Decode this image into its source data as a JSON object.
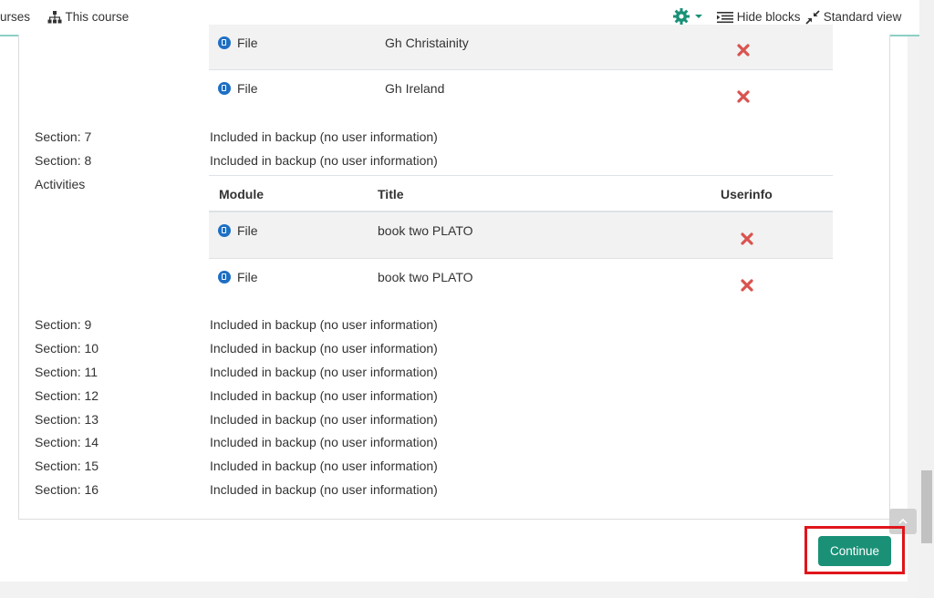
{
  "nav": {
    "courses_partial": "urses",
    "this_course": "This course",
    "hide_blocks": "Hide blocks",
    "standard_view": "Standard view"
  },
  "top_table": {
    "rows": [
      {
        "module": "File",
        "title": "Gh Christainity"
      },
      {
        "module": "File",
        "title": "Gh Ireland"
      }
    ]
  },
  "sections_a": [
    {
      "label": "Section: 7",
      "value": "Included in backup (no user information)"
    },
    {
      "label": "Section: 8",
      "value": "Included in backup (no user information)"
    }
  ],
  "activities_label": "Activities",
  "activities_table": {
    "headers": {
      "module": "Module",
      "title": "Title",
      "userinfo": "Userinfo"
    },
    "rows": [
      {
        "module": "File",
        "title": "book two PLATO"
      },
      {
        "module": "File",
        "title": "book two PLATO"
      }
    ]
  },
  "sections_b": [
    {
      "label": "Section: 9",
      "value": "Included in backup (no user information)"
    },
    {
      "label": "Section: 10",
      "value": "Included in backup (no user information)"
    },
    {
      "label": "Section: 11",
      "value": "Included in backup (no user information)"
    },
    {
      "label": "Section: 12",
      "value": "Included in backup (no user information)"
    },
    {
      "label": "Section: 13",
      "value": "Included in backup (no user information)"
    },
    {
      "label": "Section: 14",
      "value": "Included in backup (no user information)"
    },
    {
      "label": "Section: 15",
      "value": "Included in backup (no user information)"
    },
    {
      "label": "Section: 16",
      "value": "Included in backup (no user information)"
    }
  ],
  "continue_label": "Continue",
  "icons": {
    "gear": "gear-icon",
    "hierarchy": "sitemap-icon",
    "hide_blocks": "list-collapse-icon",
    "standard_view": "compress-icon",
    "file": "file-icon",
    "cross": "cross-icon"
  },
  "colors": {
    "accent": "#1a9177",
    "cross": "#d9534f",
    "file_icon": "#1e6fc4",
    "highlight": "#e0151b"
  }
}
